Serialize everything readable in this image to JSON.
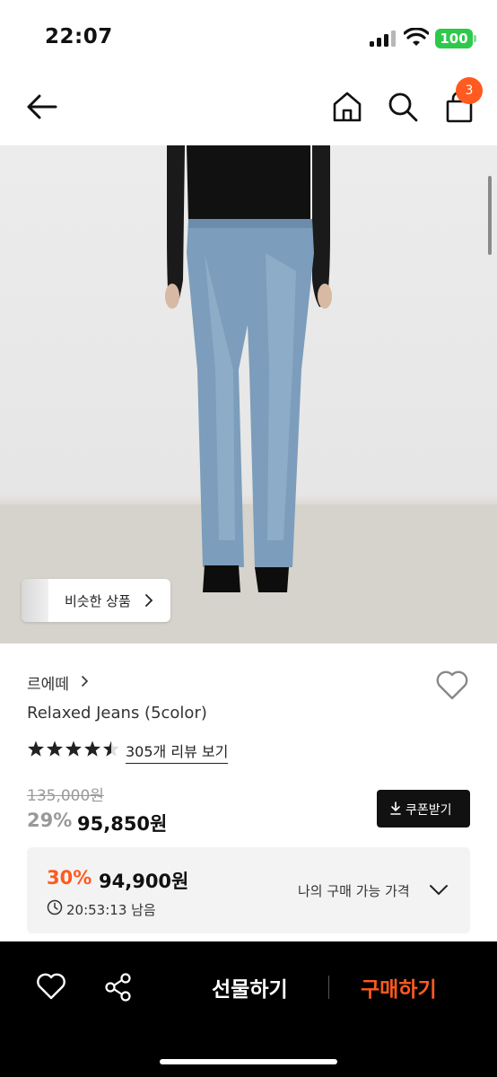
{
  "status_bar": {
    "time": "22:07",
    "battery": "100",
    "icons": [
      "signal-icon",
      "wifi-icon",
      "battery-icon"
    ]
  },
  "nav": {
    "icons": [
      "back-arrow-icon",
      "home-icon",
      "search-icon",
      "shopping-bag-icon"
    ],
    "cart_count": "3"
  },
  "image": {
    "similar_button_label": "비슷한 상품"
  },
  "product": {
    "brand": "르에떼",
    "name": "Relaxed Jeans (5color)",
    "rating": 4.5,
    "review_link": "305개 리뷰 보기",
    "original_price": "135,000원",
    "discount": "29%",
    "sale_price": "95,850원",
    "coupon_label": "쿠폰받기"
  },
  "my_price": {
    "discount": "30%",
    "price": "94,900원",
    "label": "나의 구매 가능 가격",
    "timer": "20:53:13 남음"
  },
  "bottom_bar": {
    "gift_label": "선물하기",
    "buy_label": "구매하기"
  },
  "colors": {
    "accent": "#ff5a1f",
    "battery": "#2ec94b",
    "bottom_bar": "#000000"
  }
}
